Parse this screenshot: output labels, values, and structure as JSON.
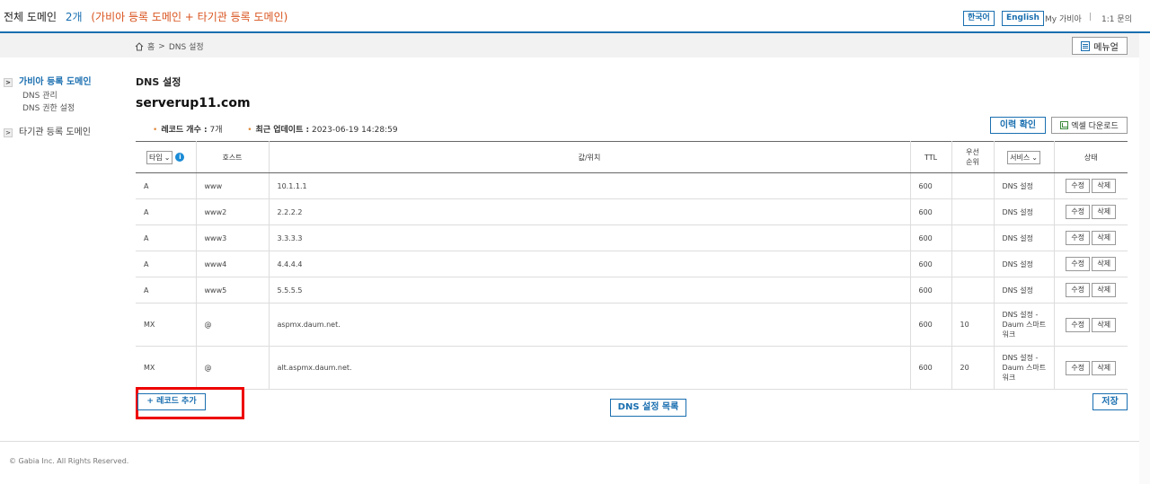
{
  "header": {
    "title": "전체 도메인",
    "count": "2개",
    "detail": "(가비아 등록 도메인 + 타기관 등록 도메인)",
    "lang_ko": "한국어",
    "lang_en": "English",
    "my_gabia": "My 가비아",
    "separator": "|",
    "inquiry": "1:1 문의"
  },
  "breadcrumb": {
    "home": "홈",
    "sep": ">",
    "current": "DNS 설정"
  },
  "manual_button": "메뉴얼",
  "sidebar": {
    "gabia_domains": "가비아 등록 도메인",
    "sub_items": [
      "DNS 관리",
      "DNS 권한 설정"
    ],
    "other_domains": "타기관 등록 도메인"
  },
  "main": {
    "section_title": "DNS 설정",
    "domain": "serverup11.com",
    "record_count_label": "레코드 개수 :",
    "record_count": "7개",
    "last_update_label": "최근 업데이트 :",
    "last_update": "2023-06-19 14:28:59",
    "history_button": "이력 확인",
    "excel_button": "엑셀 다운로드"
  },
  "table": {
    "headers": {
      "type": "타입",
      "host": "호스트",
      "value": "값/위치",
      "ttl": "TTL",
      "priority": "우선 순위",
      "service": "서비스",
      "status": "상태"
    },
    "edit_label": "수정",
    "delete_label": "삭제",
    "rows": [
      {
        "type": "A",
        "host": "www",
        "value": "10.1.1.1",
        "ttl": "600",
        "priority": "",
        "service": "DNS 설정"
      },
      {
        "type": "A",
        "host": "www2",
        "value": "2.2.2.2",
        "ttl": "600",
        "priority": "",
        "service": "DNS 설정"
      },
      {
        "type": "A",
        "host": "www3",
        "value": "3.3.3.3",
        "ttl": "600",
        "priority": "",
        "service": "DNS 설정"
      },
      {
        "type": "A",
        "host": "www4",
        "value": "4.4.4.4",
        "ttl": "600",
        "priority": "",
        "service": "DNS 설정"
      },
      {
        "type": "A",
        "host": "www5",
        "value": "5.5.5.5",
        "ttl": "600",
        "priority": "",
        "service": "DNS 설정"
      },
      {
        "type": "MX",
        "host": "@",
        "value": "aspmx.daum.net.",
        "ttl": "600",
        "priority": "10",
        "service": "DNS 설정 - Daum 스마트 워크"
      },
      {
        "type": "MX",
        "host": "@",
        "value": "alt.aspmx.daum.net.",
        "ttl": "600",
        "priority": "20",
        "service": "DNS 설정 - Daum 스마트 워크"
      }
    ]
  },
  "buttons": {
    "add_record": "+ 레코드 추가",
    "dns_list": "DNS 설정 목록",
    "save": "저장"
  },
  "footer": "© Gabia Inc. All Rights Reserved.",
  "colors": {
    "accent": "#1a6fb0",
    "highlight": "#e00000",
    "orange": "#d9531e"
  }
}
